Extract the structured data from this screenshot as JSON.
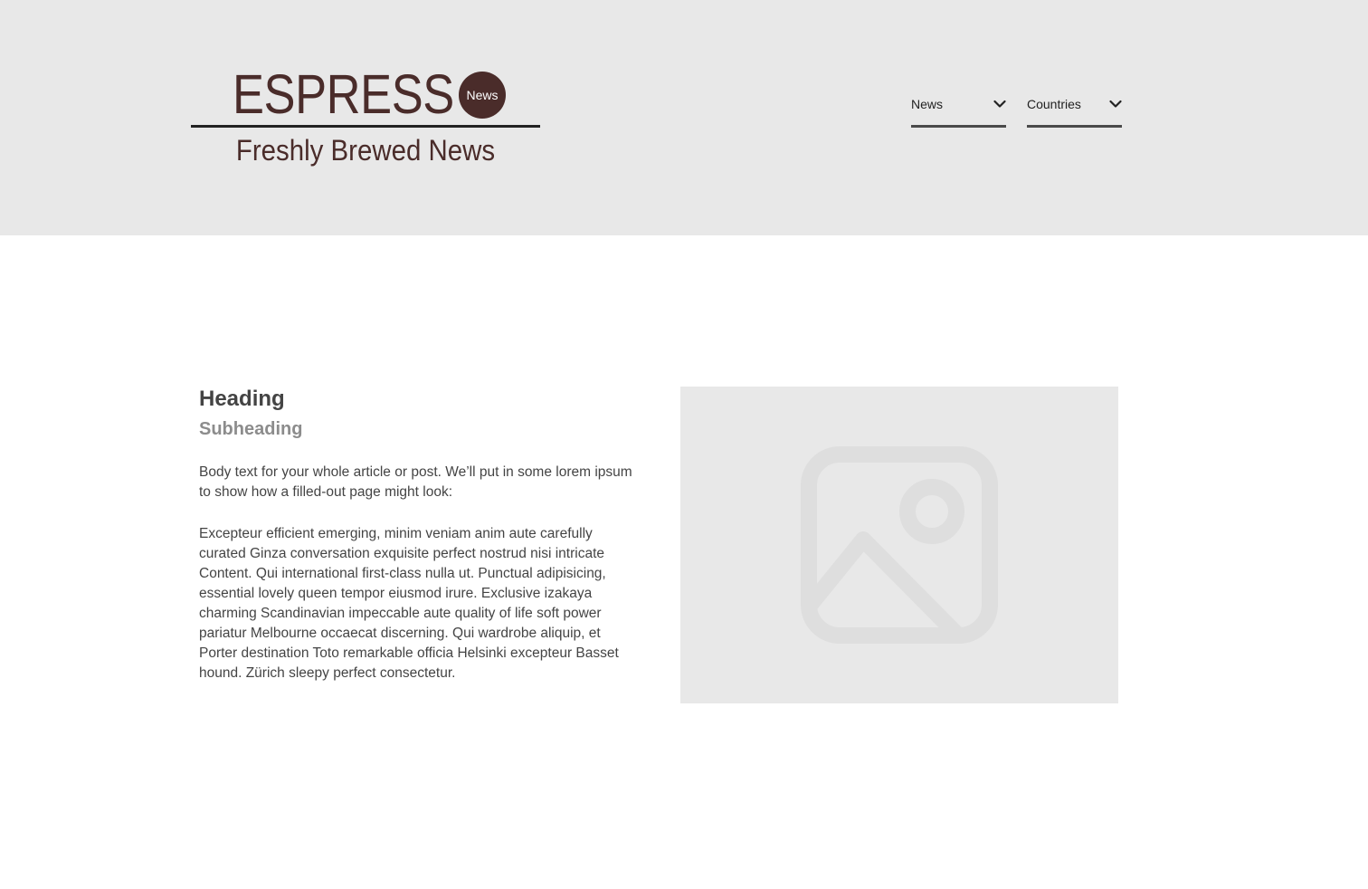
{
  "brand": {
    "wordmark": "ESPRESS",
    "badge": "News",
    "tagline": "Freshly Brewed News"
  },
  "nav": {
    "news_select": {
      "label": "News",
      "icon": "chevron-down-icon"
    },
    "countries_select": {
      "label": "Countries",
      "icon": "chevron-down-icon"
    }
  },
  "article": {
    "heading": "Heading",
    "subheading": "Subheading",
    "intro": "Body text for your whole article or post. We’ll put in some lorem ipsum to show how a filled-out page might look:",
    "body": "Excepteur efficient emerging, minim veniam anim aute carefully curated Ginza conversation exquisite perfect nostrud nisi intricate Content. Qui  international first-class nulla ut. Punctual adipisicing, essential lovely queen tempor eiusmod irure. Exclusive izakaya charming Scandinavian impeccable aute quality of life soft power pariatur Melbourne occaecat discerning. Qui wardrobe aliquip, et Porter destination Toto remarkable officia Helsinki excepteur Basset hound. Zürich sleepy perfect consectetur.",
    "image": {
      "icon": "image-placeholder-icon"
    }
  },
  "colors": {
    "brand": "#4a2c2a",
    "header_bg": "#e8e8e8",
    "text": "#444444",
    "muted": "#8c8c8c"
  }
}
